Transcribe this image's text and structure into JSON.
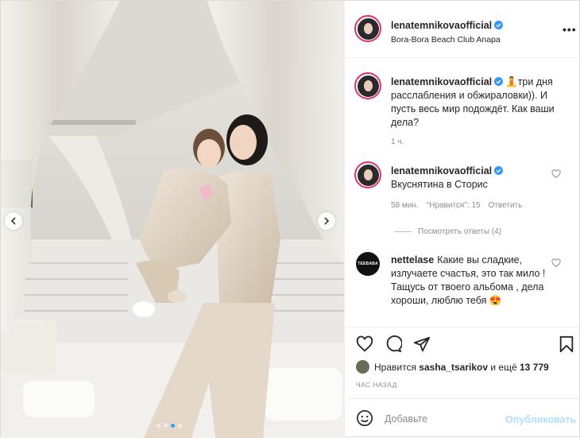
{
  "post": {
    "author": "lenatemnikovaofficial",
    "location": "Bora-Bora Beach Club Anapa",
    "more_icon": "more-dots-icon",
    "slides": 4,
    "active_slide": 3
  },
  "comments": [
    {
      "user": "lenatemnikovaofficial",
      "verified": true,
      "emoji": "🧘",
      "text": "три дня расслабления и обжираловки)). И пусть весь мир подождёт. Как ваши дела?",
      "time": "1 ч."
    },
    {
      "user": "lenatemnikovaofficial",
      "verified": true,
      "text": "Вкуснятина в Сторис",
      "time": "58 мин.",
      "likes": "\"Нравится\": 15",
      "reply": "Ответить",
      "view_replies": "Посмотреть ответы (4)"
    },
    {
      "user": "nettelase",
      "avatar_text": "TEEBABA",
      "text": "Какие вы сладкие, излучаете счастья, это так мило ! Тащусь от твоего альбома , дела хороши, люблю тебя",
      "emoji": "😍"
    }
  ],
  "likes": {
    "prefix": "Нравится",
    "user": "sasha_tsarikov",
    "middle": "и ещё",
    "count": "13 779"
  },
  "timestamp": "ЧАС НАЗАД",
  "comment_box": {
    "placeholder": "Добавьте",
    "publish": "Опубликовать"
  },
  "colors": {
    "accent": "#3897f0",
    "story_ring": "#e1306c",
    "muted": "#8e8e8e",
    "publish_disabled": "#b2dffc"
  }
}
